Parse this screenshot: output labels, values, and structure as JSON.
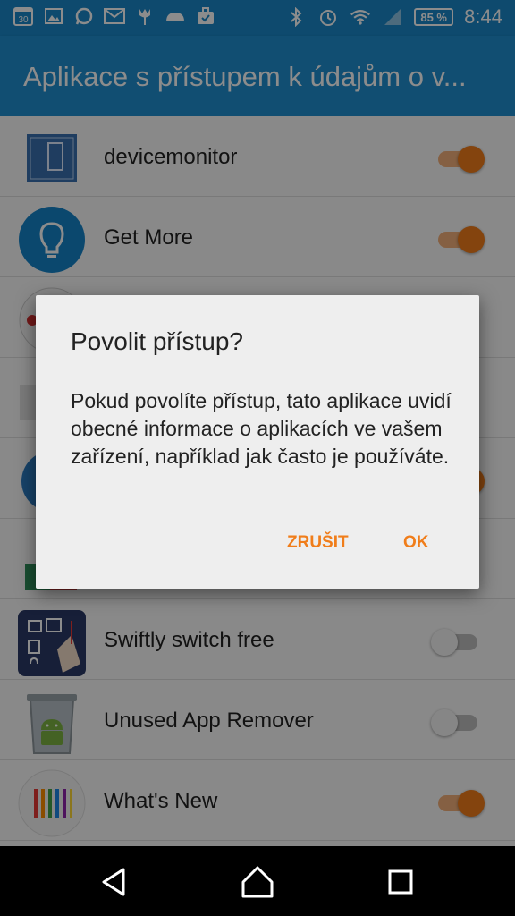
{
  "status_bar": {
    "notification_icons": [
      "calendar-icon",
      "gallery-icon",
      "whatsapp-icon",
      "gmail-icon",
      "tulip-icon",
      "cloud-icon",
      "briefcase-icon"
    ],
    "calendar_day": "30",
    "battery": "85 %",
    "time": "8:44"
  },
  "app_bar": {
    "title": "Aplikace s přístupem k údajům o v..."
  },
  "apps": [
    {
      "label": "devicemonitor",
      "enabled": true
    },
    {
      "label": "Get More",
      "enabled": true
    },
    {
      "label": "",
      "enabled": false
    },
    {
      "label": "",
      "enabled": false
    },
    {
      "label": "",
      "enabled": true
    },
    {
      "label": "",
      "enabled": false
    },
    {
      "label": "Swiftly switch free",
      "enabled": false
    },
    {
      "label": "Unused App Remover",
      "enabled": false
    },
    {
      "label": "What's New",
      "enabled": true
    }
  ],
  "dialog": {
    "title": "Povolit přístup?",
    "message": "Pokud povolíte přístup, tato aplikace uvidí obecné informace o aplikacích ve vašem zařízení, například jak často je používáte.",
    "cancel_label": "ZRUŠIT",
    "ok_label": "OK"
  },
  "colors": {
    "status_bar": "#1a88c9",
    "app_bar": "#1f8fd0",
    "accent": "#f07d1a"
  },
  "nav_bar": {
    "icons": [
      "back-icon",
      "home-icon",
      "recents-icon"
    ]
  }
}
